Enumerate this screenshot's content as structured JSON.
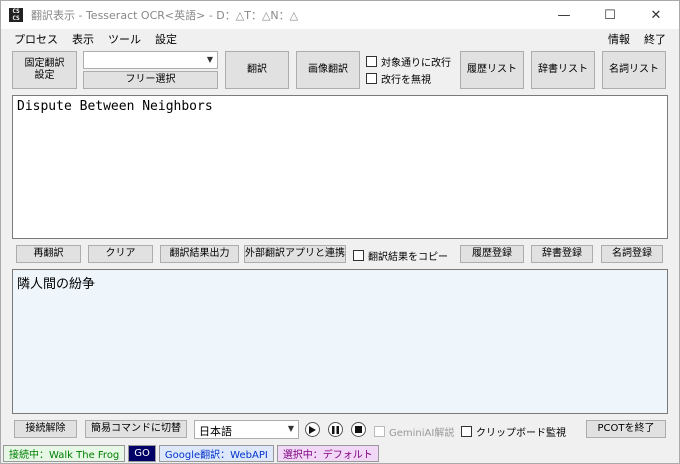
{
  "window": {
    "title": "翻訳表示 - Tesseract OCR<英語> - D：△T：△N：△",
    "controls": {
      "minimize": "—",
      "maximize": "☐",
      "close": "✕"
    }
  },
  "menu": {
    "left": [
      "プロセス",
      "表示",
      "ツール",
      "設定"
    ],
    "right": [
      "情報",
      "終了"
    ]
  },
  "toolbar": {
    "fixed_translation": "固定翻訳\n設定",
    "combo_value": "",
    "free_select": "フリー選択",
    "translate": "翻訳",
    "image_translate": "画像翻訳",
    "check_linebreak": "対象通りに改行",
    "check_ignore_linebreak": "改行を無視",
    "history_list": "履歴リスト",
    "dictionary_list": "辞書リスト",
    "noun_list": "名詞リスト"
  },
  "source_text": "Dispute Between Neighbors",
  "middle_bar": {
    "retranslate": "再翻訳",
    "clear": "クリア",
    "output_result": "翻訳結果出力",
    "external_app": "外部翻訳アプリと連携",
    "copy_result": "翻訳結果をコピー",
    "register_history": "履歴登録",
    "register_dictionary": "辞書登録",
    "register_noun": "名詞登録"
  },
  "translated_text": "隣人間の紛争",
  "bottom_bar": {
    "disconnect": "接続解除",
    "simple_command": "簡易コマンドに切替",
    "language": "日本語",
    "gemini": "GeminiAI解説",
    "clipboard_monitor": "クリップボード監視",
    "exit_pcot": "PCOTを終了"
  },
  "status": {
    "connection": "接続中：Walk The Frog",
    "go": "GO",
    "google": "Google翻訳：WebAPI",
    "selected": "選択中：デフォルト"
  },
  "colors": {
    "status_connection_bg": "#e6f7e6",
    "status_connection_fg": "#008000",
    "go_bg": "#000066",
    "go_fg": "#ffffff",
    "google_bg": "#dde8fb",
    "google_fg": "#0033cc",
    "selected_bg": "#f0d8f6",
    "selected_fg": "#800080",
    "translated_bg": "#eef6fc"
  }
}
